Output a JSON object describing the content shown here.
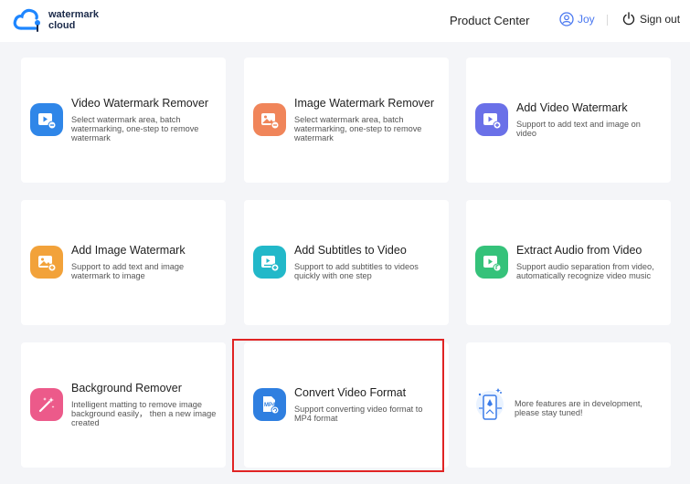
{
  "brand": {
    "line1": "watermark",
    "line2": "cloud"
  },
  "nav": {
    "product_center": "Product Center",
    "username": "Joy",
    "sign_out": "Sign out"
  },
  "cards": [
    {
      "title": "Video Watermark Remover",
      "desc": "Select watermark area, batch watermarking, one-step to remove watermark",
      "icon": "video-remove-icon",
      "color": "#2f86e8"
    },
    {
      "title": "Image Watermark Remover",
      "desc": "Select watermark area, batch watermarking, one-step to remove watermark",
      "icon": "image-remove-icon",
      "color": "#f0855a"
    },
    {
      "title": "Add Video Watermark",
      "desc": "Support to add text and image on video",
      "icon": "video-add-icon",
      "color": "#6a70e8"
    },
    {
      "title": "Add Image Watermark",
      "desc": "Support to add text and image watermark to image",
      "icon": "image-add-icon",
      "color": "#f2a23a"
    },
    {
      "title": "Add Subtitles to Video",
      "desc": "Support to add subtitles to videos quickly with one step",
      "icon": "subtitle-icon",
      "color": "#22b8c9"
    },
    {
      "title": "Extract Audio from Video",
      "desc": "Support audio separation from video, automatically recognize video music",
      "icon": "audio-extract-icon",
      "color": "#35c27a"
    },
    {
      "title": "Background Remover",
      "desc": "Intelligent matting to remove image background easily， then a new image created",
      "icon": "background-remove-icon",
      "color": "#ec5a8a"
    },
    {
      "title": "Convert Video Format",
      "desc": "Support converting video format to MP4 format",
      "icon": "mp4-convert-icon",
      "color": "#2f7fe0",
      "icon_label": "MP4"
    }
  ],
  "more": {
    "desc": "More features are in development, please stay tuned!"
  }
}
